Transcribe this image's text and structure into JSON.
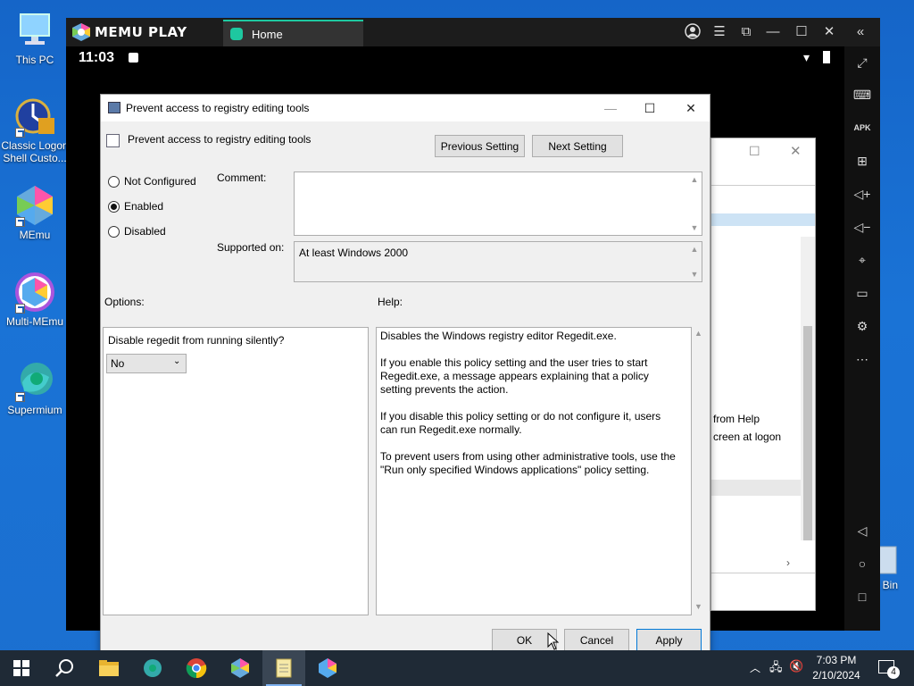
{
  "desktop": {
    "icons": [
      {
        "label": "This PC"
      },
      {
        "label": "Classic Logon Shell Custo..."
      },
      {
        "label": "MEmu"
      },
      {
        "label": "Multi-MEmu"
      },
      {
        "label": "Supermium"
      },
      {
        "label": "Bin"
      }
    ]
  },
  "memu": {
    "logo_text": "MEMU PLAY",
    "tab_label": "Home",
    "status_time": "11:03"
  },
  "background_window": {
    "text_line1": "from Help",
    "text_line2": "creen at logon"
  },
  "dialog": {
    "title": "Prevent access to registry editing tools",
    "policy_name": "Prevent access to registry editing tools",
    "previous_setting": "Previous Setting",
    "next_setting": "Next Setting",
    "radio_not_configured": "Not Configured",
    "radio_enabled": "Enabled",
    "radio_disabled": "Disabled",
    "selected": "Enabled",
    "comment_label": "Comment:",
    "comment_value": "",
    "supported_label": "Supported on:",
    "supported_value": "At least Windows 2000",
    "options_label": "Options:",
    "help_label": "Help:",
    "option_question": "Disable regedit from running silently?",
    "option_select_value": "No",
    "help_text": "Disables the Windows registry editor Regedit.exe.\n\nIf you enable this policy setting and the user tries to start Regedit.exe, a message appears explaining that a policy setting prevents the action.\n\nIf you disable this policy setting or do not configure it, users can run Regedit.exe normally.\n\nTo prevent users from using other administrative tools, use the \"Run only specified Windows applications\" policy setting.",
    "ok": "OK",
    "cancel": "Cancel",
    "apply": "Apply"
  },
  "taskbar": {
    "time": "7:03 PM",
    "date": "2/10/2024",
    "notification_count": "4"
  },
  "colors": {
    "desktop": "#1a6fd2",
    "memu_accent": "#1ec8a0",
    "taskbar": "#1f2a36"
  }
}
